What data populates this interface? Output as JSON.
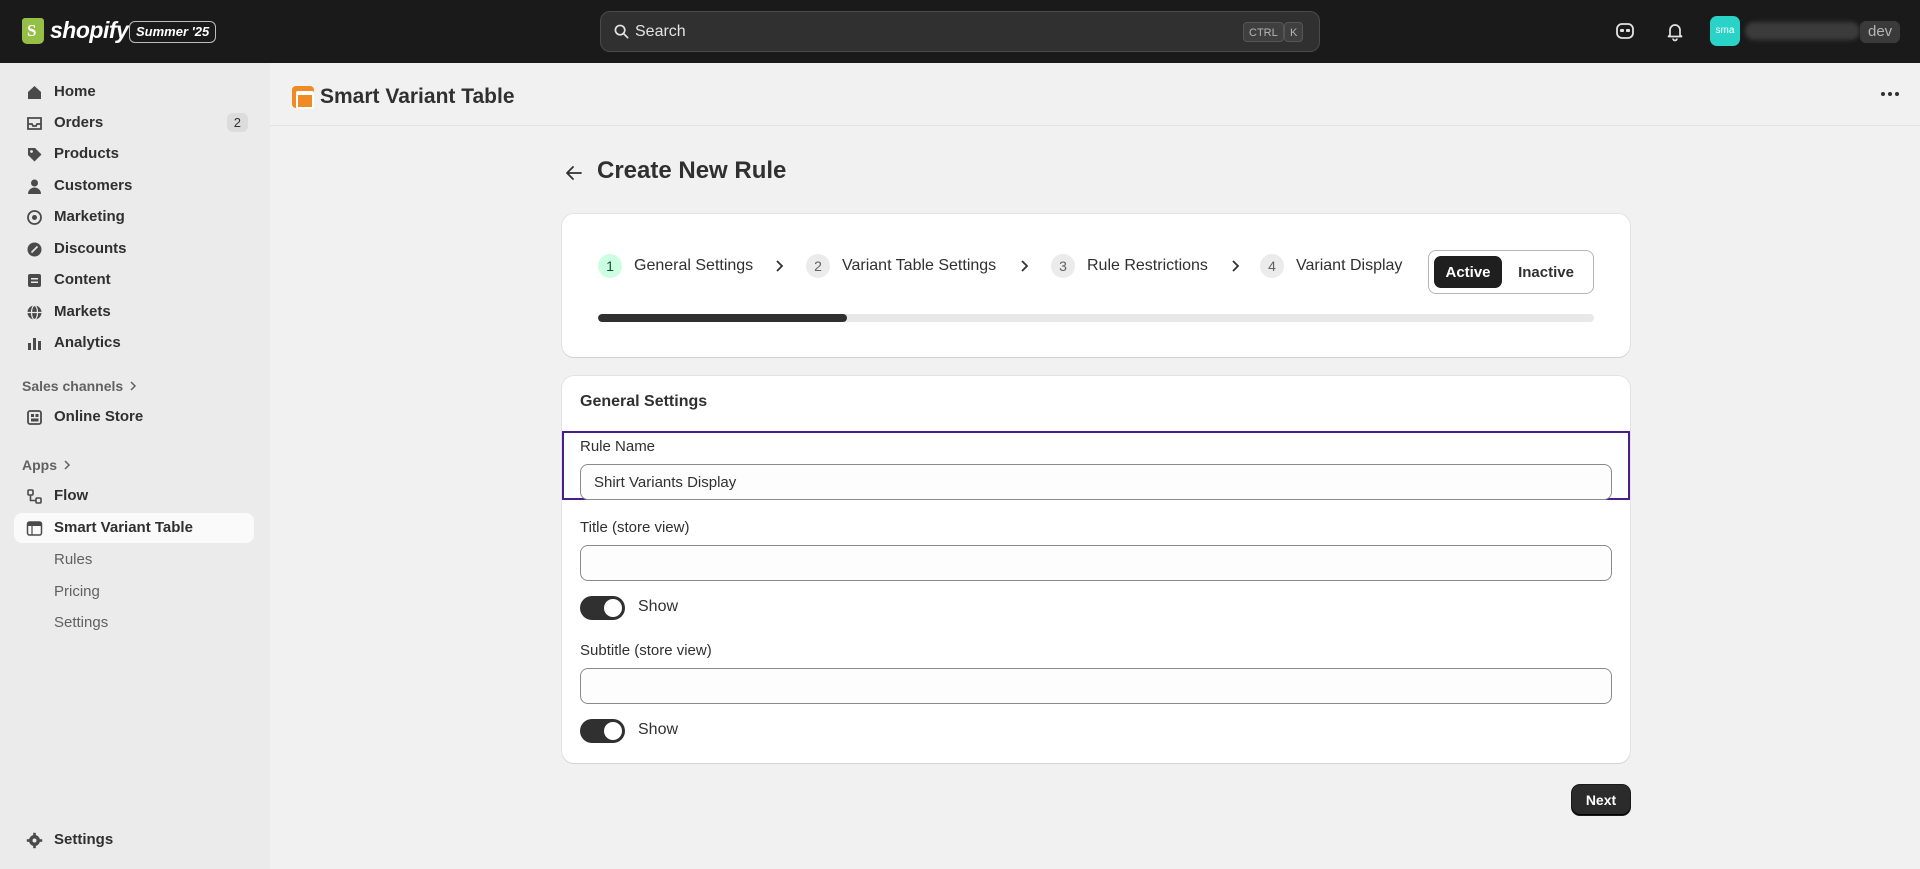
{
  "topbar": {
    "brand": "shopify",
    "edition_badge": "Summer '25",
    "search_placeholder": "Search",
    "shortcut_ctrl": "CTRL",
    "shortcut_key": "K",
    "avatar_initials": "sma",
    "store_badge": "dev"
  },
  "sidebar": {
    "items": [
      {
        "label": "Home",
        "icon": "home-icon"
      },
      {
        "label": "Orders",
        "icon": "inbox-icon",
        "count": "2"
      },
      {
        "label": "Products",
        "icon": "tag-icon"
      },
      {
        "label": "Customers",
        "icon": "person-icon"
      },
      {
        "label": "Marketing",
        "icon": "target-icon"
      },
      {
        "label": "Discounts",
        "icon": "discount-icon"
      },
      {
        "label": "Content",
        "icon": "content-icon"
      },
      {
        "label": "Markets",
        "icon": "globe-icon"
      },
      {
        "label": "Analytics",
        "icon": "bar-chart-icon"
      }
    ],
    "sales_channels_label": "Sales channels",
    "online_store_label": "Online Store",
    "apps_label": "Apps",
    "flow_label": "Flow",
    "app_label": "Smart Variant Table",
    "app_subitems": [
      "Rules",
      "Pricing",
      "Settings"
    ],
    "settings_label": "Settings"
  },
  "app_header": {
    "title": "Smart Variant Table"
  },
  "page": {
    "title": "Create New Rule"
  },
  "steps": {
    "items": [
      {
        "num": "1",
        "label": "General Settings"
      },
      {
        "num": "2",
        "label": "Variant Table Settings"
      },
      {
        "num": "3",
        "label": "Rule Restrictions"
      },
      {
        "num": "4",
        "label": "Variant Display"
      }
    ],
    "status_active": "Active",
    "status_inactive": "Inactive",
    "progress_percent": 25
  },
  "general_settings": {
    "title": "General Settings",
    "rule_name_label": "Rule Name",
    "rule_name_value": "Shirt Variants Display",
    "title_label": "Title (store view)",
    "title_value": "",
    "title_show_label": "Show",
    "subtitle_label": "Subtitle (store view)",
    "subtitle_value": "",
    "subtitle_show_label": "Show"
  },
  "actions": {
    "next_label": "Next"
  },
  "colors": {
    "topbar_bg": "#1a1a1a",
    "focus_outline": "#4a1c8c",
    "current_step_bg": "#cdfee1",
    "app_icon": "#f08a24",
    "avatar_bg": "#2ad3c7"
  }
}
